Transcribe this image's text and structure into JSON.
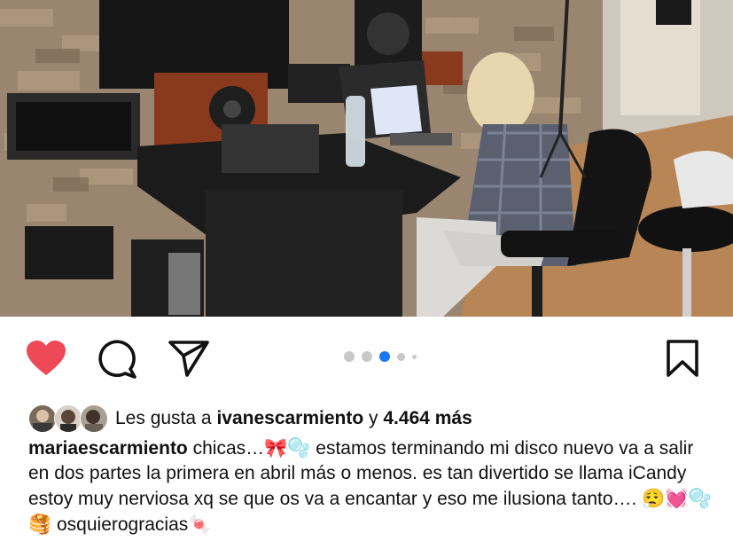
{
  "post": {
    "liked": true,
    "carousel": {
      "count": 5,
      "active_index": 2
    }
  },
  "icons": {
    "like": "heart-filled-icon",
    "comment": "comment-bubble-icon",
    "share": "paper-plane-icon",
    "save": "bookmark-icon"
  },
  "colors": {
    "like_red": "#ed4956",
    "dot_active": "#1877f2",
    "dot_inactive": "#c8c8c8"
  },
  "likes": {
    "prefix": "Les gusta a",
    "user": "ivanescarmiento",
    "connector": "y",
    "count": "4.464 más"
  },
  "caption": {
    "username": "mariaescarmiento",
    "part1": "chicas…",
    "emoji1": "🎀🫧",
    "part2": "estamos terminando mi disco nuevo va a salir en dos partes la primera en abril más o menos.  es tan divertido se llama iCandy estoy muy nerviosa xq se que os va a encantar y eso me ilusiona tanto….",
    "emoji2": "😮‍💨💓🫧🥞",
    "part3": "osquierogracias",
    "emoji3": "🍬"
  }
}
